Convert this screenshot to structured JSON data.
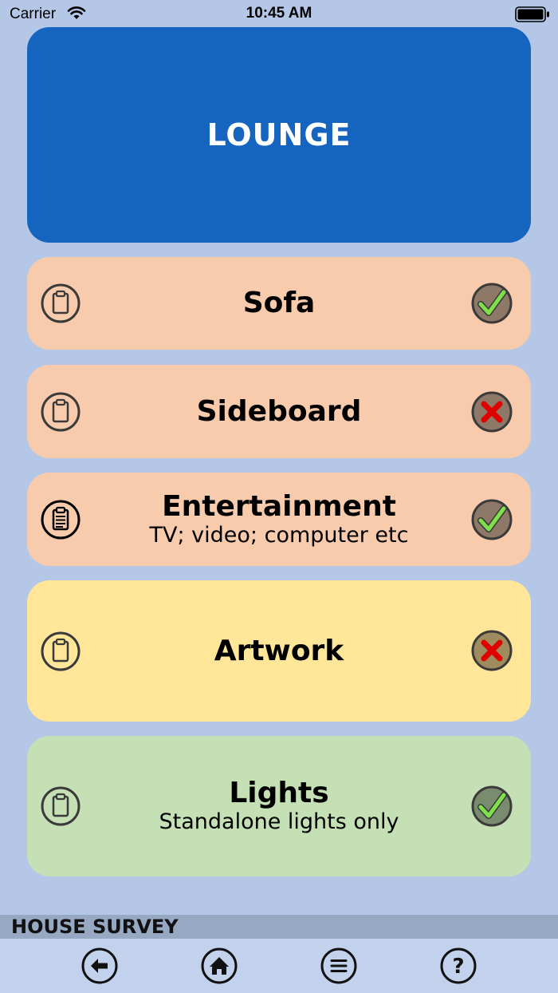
{
  "status_bar": {
    "carrier": "Carrier",
    "time": "10:45 AM"
  },
  "header": {
    "title": "LOUNGE",
    "color": "#1565c0"
  },
  "items": [
    {
      "title": "Sofa",
      "subtitle": "",
      "status": "check",
      "note_state": "empty",
      "color": "#f8cbad"
    },
    {
      "title": "Sideboard",
      "subtitle": "",
      "status": "cross",
      "note_state": "empty",
      "color": "#f8cbad"
    },
    {
      "title": "Entertainment",
      "subtitle": "TV; video; computer etc",
      "status": "check",
      "note_state": "filled",
      "color": "#f8cbad"
    },
    {
      "title": "Artwork",
      "subtitle": "",
      "status": "cross",
      "note_state": "empty",
      "color": "#ffe699"
    },
    {
      "title": "Lights",
      "subtitle": "Standalone lights only",
      "status": "check",
      "note_state": "empty",
      "color": "#c5e0b4"
    }
  ],
  "footer": {
    "label": "HOUSE SURVEY"
  },
  "toolbar": {
    "buttons": [
      {
        "icon": "back-arrow-icon"
      },
      {
        "icon": "home-icon"
      },
      {
        "icon": "menu-icon"
      },
      {
        "icon": "help-icon"
      }
    ]
  }
}
